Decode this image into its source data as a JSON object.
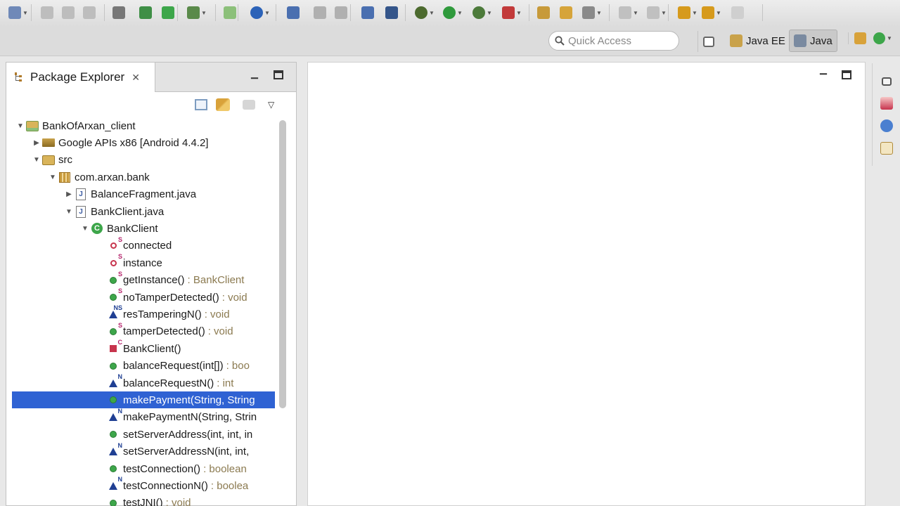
{
  "toolbar": {
    "icons": [
      "new-icon",
      "save-icon",
      "save-all-icon",
      "print-icon",
      "android-sdk-icon",
      "download-icon",
      "avd-manager-icon",
      "checkbox-icon",
      "project-icon",
      "help-icon",
      "skip-breakpoints-icon",
      "pen-icon",
      "wand-icon",
      "window-icon",
      "device-icon",
      "debug-icon",
      "run-icon",
      "coverage-icon",
      "external-tools-icon",
      "open-type-icon",
      "open-task-icon",
      "search-icon",
      "next-annotation-icon",
      "prev-annotation-icon",
      "back-icon",
      "forward-icon",
      "pin-icon"
    ]
  },
  "quick_access": {
    "placeholder": "Quick Access"
  },
  "perspectives": [
    {
      "label": "Java EE",
      "icon": "javaee-perspective-icon",
      "active": false
    },
    {
      "label": "Java",
      "icon": "java-perspective-icon",
      "active": true
    }
  ],
  "package_explorer": {
    "title": "Package Explorer",
    "tree": [
      {
        "level": 0,
        "toggle": "open",
        "icon": "android-project-icon",
        "label": "BankOfArxan_client",
        "type": ""
      },
      {
        "level": 1,
        "toggle": "closed",
        "icon": "library-icon",
        "label": "Google APIs x86 [Android 4.4.2]",
        "type": ""
      },
      {
        "level": 1,
        "toggle": "open",
        "icon": "source-folder-icon",
        "label": "src",
        "type": ""
      },
      {
        "level": 2,
        "toggle": "open",
        "icon": "package-icon",
        "label": "com.arxan.bank",
        "type": ""
      },
      {
        "level": 3,
        "toggle": "closed",
        "icon": "java-file-icon",
        "label": "BalanceFragment.java",
        "type": ""
      },
      {
        "level": 3,
        "toggle": "open",
        "icon": "java-file-icon",
        "label": "BankClient.java",
        "type": ""
      },
      {
        "level": 4,
        "toggle": "open",
        "icon": "class-icon",
        "label": "BankClient",
        "type": ""
      },
      {
        "level": 5,
        "toggle": "",
        "icon": "private-static-field-icon",
        "sup": "S",
        "label": "connected",
        "type": ""
      },
      {
        "level": 5,
        "toggle": "",
        "icon": "private-static-field-icon",
        "sup": "S",
        "label": "instance",
        "type": ""
      },
      {
        "level": 5,
        "toggle": "",
        "icon": "public-static-method-icon",
        "sup": "S",
        "label": "getInstance()",
        "type": ": BankClient"
      },
      {
        "level": 5,
        "toggle": "",
        "icon": "public-static-method-icon",
        "sup": "S",
        "label": "noTamperDetected()",
        "type": ": void"
      },
      {
        "level": 5,
        "toggle": "",
        "icon": "native-static-method-icon",
        "sup": "NS",
        "label": "resTamperingN()",
        "type": ": void"
      },
      {
        "level": 5,
        "toggle": "",
        "icon": "public-static-method-icon",
        "sup": "S",
        "label": "tamperDetected()",
        "type": ": void"
      },
      {
        "level": 5,
        "toggle": "",
        "icon": "private-constructor-icon",
        "sup": "C",
        "label": "BankClient()",
        "type": ""
      },
      {
        "level": 5,
        "toggle": "",
        "icon": "public-method-icon",
        "label": "balanceRequest(int[])",
        "type": ": boo"
      },
      {
        "level": 5,
        "toggle": "",
        "icon": "native-method-icon",
        "sup": "N",
        "label": "balanceRequestN()",
        "type": ": int"
      },
      {
        "level": 5,
        "toggle": "",
        "icon": "public-method-icon",
        "label": "makePayment(String, String",
        "type": "",
        "selected": true
      },
      {
        "level": 5,
        "toggle": "",
        "icon": "native-method-icon",
        "sup": "N",
        "label": "makePaymentN(String, Strin",
        "type": ""
      },
      {
        "level": 5,
        "toggle": "",
        "icon": "public-method-icon",
        "label": "setServerAddress(int, int, in",
        "type": ""
      },
      {
        "level": 5,
        "toggle": "",
        "icon": "native-method-icon",
        "sup": "N",
        "label": "setServerAddressN(int, int,",
        "type": ""
      },
      {
        "level": 5,
        "toggle": "",
        "icon": "public-method-icon",
        "label": "testConnection()",
        "type": ": boolean"
      },
      {
        "level": 5,
        "toggle": "",
        "icon": "native-method-icon",
        "sup": "N",
        "label": "testConnectionN()",
        "type": ": boolea"
      },
      {
        "level": 5,
        "toggle": "",
        "icon": "public-method-icon",
        "label": "testJNI()",
        "type": ": void"
      }
    ]
  },
  "colors": {
    "selection": "#2f62d3",
    "method_green": "#3da64a",
    "native_blue": "#1f3f93",
    "private_red": "#c7344d",
    "type_text": "#8b7a50"
  }
}
